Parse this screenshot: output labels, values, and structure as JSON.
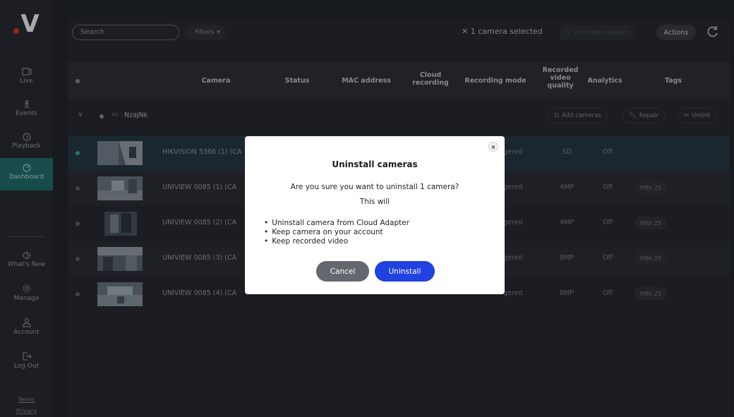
{
  "sidebar": {
    "logo_text": "V",
    "items": [
      {
        "label": "Live"
      },
      {
        "label": "Events"
      },
      {
        "label": "Playback"
      },
      {
        "label": "Dashboard"
      },
      {
        "label": "What's New"
      },
      {
        "label": "Manage"
      },
      {
        "label": "Account"
      },
      {
        "label": "Log Out"
      }
    ],
    "terms": "Terms",
    "privacy": "Privacy"
  },
  "toolbar": {
    "search_placeholder": "Search",
    "filters_label": "Filters",
    "selected_text": "1 camera selected",
    "link_adapter_label": "Link new adapter",
    "actions_label": "Actions"
  },
  "table": {
    "columns": [
      "Camera",
      "Status",
      "MAC address",
      "Cloud recording",
      "Recording mode",
      "Recorded video quality",
      "Analytics",
      "Tags"
    ],
    "group": {
      "name": "NzajNk",
      "add_cameras": "Add cameras",
      "repair": "Repair",
      "unlink": "Unlink"
    },
    "rows": [
      {
        "camera": "HIKVISION 5366 (1) (CA",
        "mode": "gered",
        "quality": "SD",
        "analytics": "Off",
        "tag": ""
      },
      {
        "camera": "UNIVIEW 0085 (1) (CA",
        "mode": "gered",
        "quality": "4MP",
        "analytics": "Off",
        "tag": "Fifth 25"
      },
      {
        "camera": "UNIVIEW 0085 (2) (CA",
        "mode": "gered",
        "quality": "4MP",
        "analytics": "Off",
        "tag": "Fifth 25"
      },
      {
        "camera": "UNIVIEW 0085 (3) (CA",
        "mode": "gered",
        "quality": "8MP",
        "analytics": "Off",
        "tag": "Fifth 25"
      },
      {
        "camera": "UNIVIEW 0085 (4) (CA",
        "mode": "gered",
        "quality": "8MP",
        "analytics": "Off",
        "tag": "Fifth 25"
      }
    ]
  },
  "dialog": {
    "close": "×",
    "title": "Uninstall cameras",
    "question": "Are you sure you want to uninstall 1 camera?",
    "this_will": "This will",
    "bullets": [
      "Uninstall camera from Cloud Adapter",
      "Keep camera on your account",
      "Keep recorded video"
    ],
    "cancel": "Cancel",
    "uninstall": "Uninstall"
  },
  "colors": {
    "accent_blue": "#2141e0",
    "active_nav": "#1f6f6c",
    "selected_check": "#2bb3a8",
    "logo_dot": "#e4342c"
  }
}
